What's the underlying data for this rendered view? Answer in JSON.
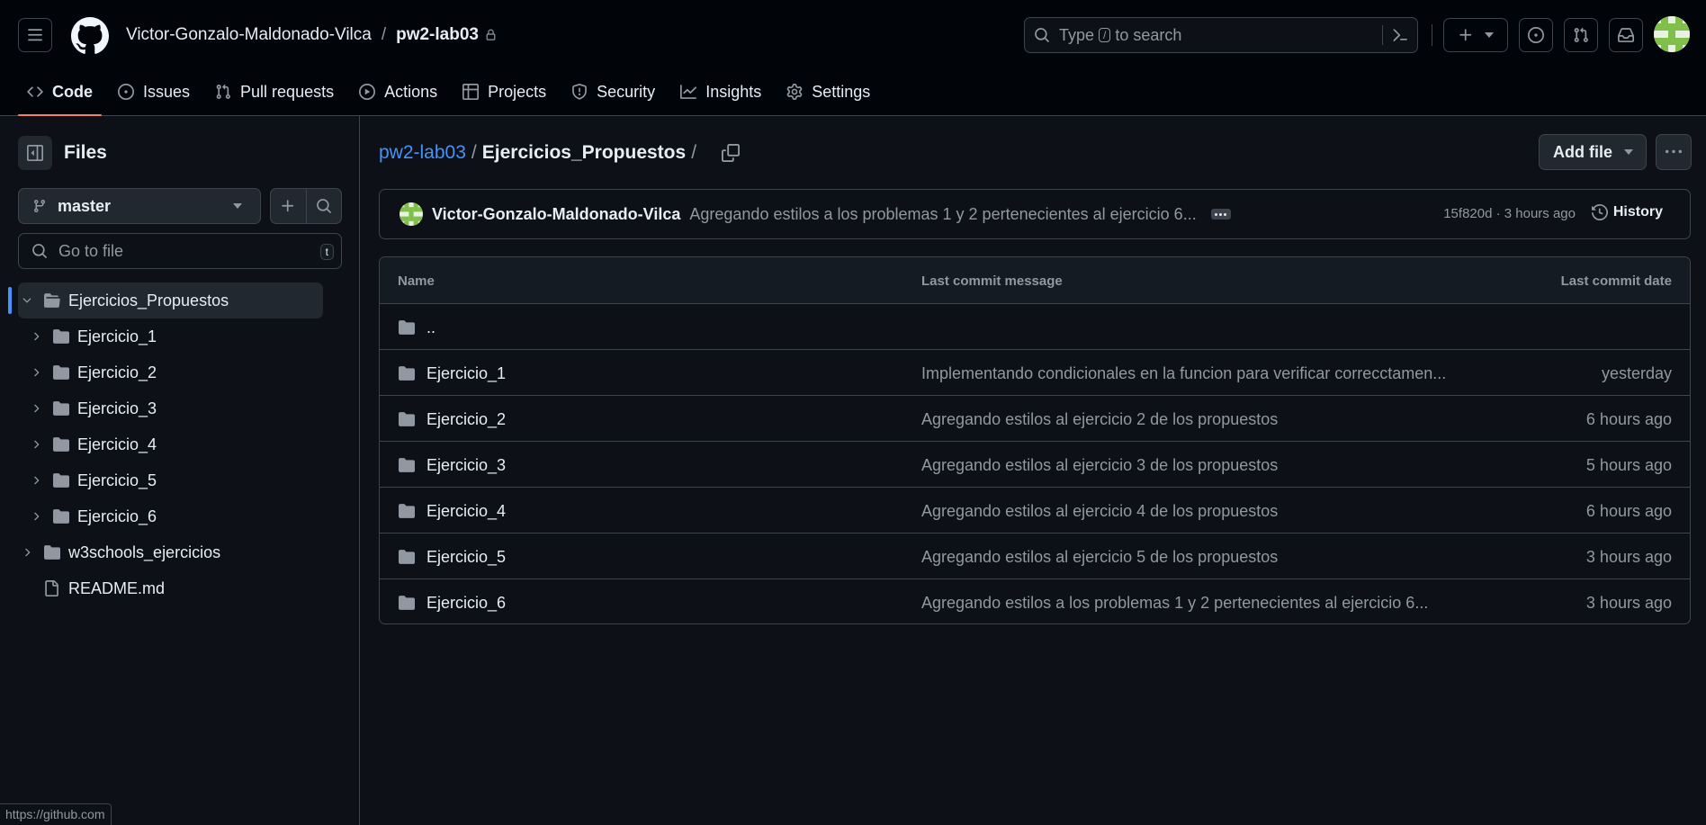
{
  "header": {
    "owner": "Victor-Gonzalo-Maldonado-Vilca",
    "separator": "/",
    "repo": "pw2-lab03",
    "search": {
      "prefix": "Type",
      "key": "/",
      "suffix": "to search"
    }
  },
  "tabs": [
    {
      "label": "Code",
      "icon": "code-icon",
      "active": true
    },
    {
      "label": "Issues",
      "icon": "issue-opened-icon"
    },
    {
      "label": "Pull requests",
      "icon": "git-pull-request-icon"
    },
    {
      "label": "Actions",
      "icon": "play-icon"
    },
    {
      "label": "Projects",
      "icon": "table-icon"
    },
    {
      "label": "Security",
      "icon": "shield-icon"
    },
    {
      "label": "Insights",
      "icon": "graph-icon"
    },
    {
      "label": "Settings",
      "icon": "gear-icon"
    }
  ],
  "sidebar": {
    "title": "Files",
    "branch": "master",
    "goto_placeholder": "Go to file",
    "goto_key": "t",
    "tree": [
      {
        "label": "Ejercicios_Propuestos",
        "type": "folder",
        "expanded": true,
        "selected": true,
        "level": 0
      },
      {
        "label": "Ejercicio_1",
        "type": "folder",
        "level": 1
      },
      {
        "label": "Ejercicio_2",
        "type": "folder",
        "level": 1
      },
      {
        "label": "Ejercicio_3",
        "type": "folder",
        "level": 1
      },
      {
        "label": "Ejercicio_4",
        "type": "folder",
        "level": 1
      },
      {
        "label": "Ejercicio_5",
        "type": "folder",
        "level": 1
      },
      {
        "label": "Ejercicio_6",
        "type": "folder",
        "level": 1
      },
      {
        "label": "w3schools_ejercicios",
        "type": "folder",
        "level": 0
      },
      {
        "label": "README.md",
        "type": "file",
        "level": 0
      }
    ]
  },
  "main": {
    "breadcrumb": {
      "repo": "pw2-lab03",
      "sep": "/",
      "current": "Ejercicios_Propuestos",
      "trailing": "/"
    },
    "add_file_label": "Add file",
    "commit": {
      "author": "Victor-Gonzalo-Maldonado-Vilca",
      "message": "Agregando estilos a los problemas 1 y 2 pertenecientes al ejercicio 6...",
      "meta": "15f820d · 3 hours ago",
      "history_label": "History"
    },
    "table": {
      "headers": {
        "name": "Name",
        "message": "Last commit message",
        "date": "Last commit date"
      },
      "parent_label": "..",
      "rows": [
        {
          "name": "Ejercicio_1",
          "message": "Implementando condicionales en la funcion para verificar correcctamen...",
          "date": "yesterday"
        },
        {
          "name": "Ejercicio_2",
          "message": "Agregando estilos al ejercicio 2 de los propuestos",
          "date": "6 hours ago"
        },
        {
          "name": "Ejercicio_3",
          "message": "Agregando estilos al ejercicio 3 de los propuestos",
          "date": "5 hours ago"
        },
        {
          "name": "Ejercicio_4",
          "message": "Agregando estilos al ejercicio 4 de los propuestos",
          "date": "6 hours ago"
        },
        {
          "name": "Ejercicio_5",
          "message": "Agregando estilos al ejercicio 5 de los propuestos",
          "date": "3 hours ago"
        },
        {
          "name": "Ejercicio_6",
          "message": "Agregando estilos a los problemas 1 y 2 pertenecientes al ejercicio 6...",
          "date": "3 hours ago"
        }
      ]
    }
  },
  "status_url": "https://github.com",
  "colors": {
    "background": "#0d1117",
    "header_bg": "#010409",
    "border": "#3d444d",
    "accent_link": "#4493f8",
    "active_tab_underline": "#f78166",
    "muted_text": "#9198a1"
  }
}
